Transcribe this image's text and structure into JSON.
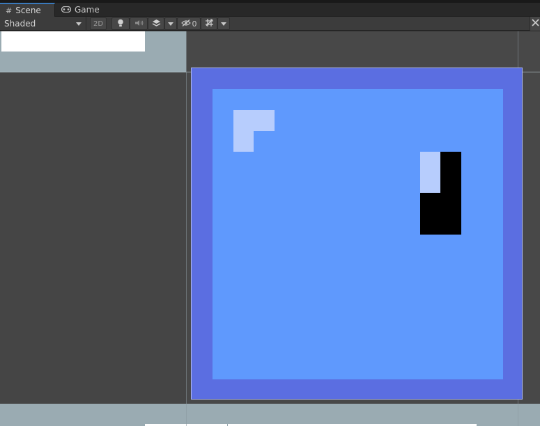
{
  "tabs": [
    {
      "label": "Scene",
      "icon": "grid-icon",
      "active": true
    },
    {
      "label": "Game",
      "icon": "gamepad-icon",
      "active": false
    }
  ],
  "toolbar": {
    "shading_mode": "Shaded",
    "mode_2d_label": "2D",
    "hidden_count": "0",
    "icons": [
      "lighting-icon",
      "audio-icon",
      "effects-icon",
      "chevron-down-icon",
      "visibility-icon",
      "grid-snap-icon",
      "chevron-down-icon",
      "tools-icon"
    ]
  },
  "scene": {
    "background_color": "#484848",
    "band_color": "#9aabb2",
    "board_border_color": "#5b6ee1",
    "board_fill_color": "#5f99fd",
    "light_tile_color": "#b7cdfd",
    "dark_tile_color": "#000000"
  }
}
